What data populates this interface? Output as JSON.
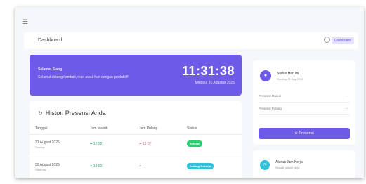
{
  "menu_icon": "hamburger-icon",
  "topbar": {
    "breadcrumb": "Dashboard",
    "search_icon": "search-icon",
    "badge": "Dashboard"
  },
  "welcome": {
    "greeting": "Selamat Siang",
    "message": "Selamat datang kembali, mari awali hari dengan produktif!",
    "clock": "11:31:38",
    "date": "Minggu, 31 Agustus 2025"
  },
  "history": {
    "title": "Histori Presensi Anda",
    "columns": [
      "Tanggal",
      "Jam Masuk",
      "Jam Pulang",
      "Status"
    ],
    "rows": [
      {
        "date": "31 August 2025",
        "day": "Sunday",
        "in": "•• 12:52",
        "out": "•• 13:07",
        "status": "Selesai"
      },
      {
        "date": "30 August 2025",
        "day": "Saturday",
        "in": "•• 14:50",
        "out": "•• -",
        "status": "Sedang Bekerja"
      }
    ]
  },
  "status_card": {
    "title": "Status Hari Ini",
    "subtitle": "Sunday, 31 Aug 2025",
    "rows": [
      {
        "label": "Presensi Masuk",
        "value": "---"
      },
      {
        "label": "Presensi Pulang",
        "value": "---"
      }
    ],
    "button": "Presensi"
  },
  "rules_card": {
    "title": "Aturan Jam Kerja",
    "subtitle": "Sesuai jadwal kerja"
  },
  "colors": {
    "accent": "#6d5ae6",
    "success": "#2ecc71",
    "info": "#2fc1d9",
    "danger": "#e06a8a"
  }
}
